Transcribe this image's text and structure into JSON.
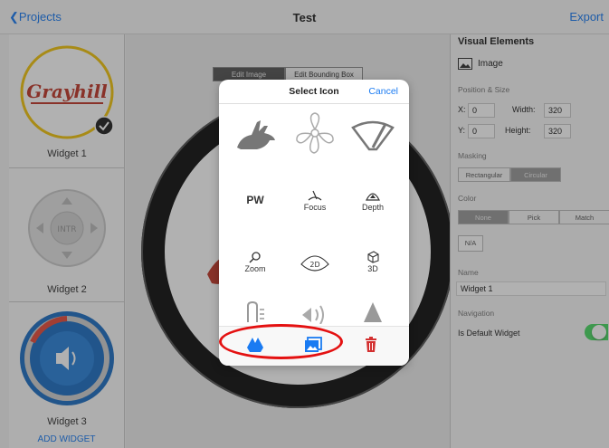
{
  "navbar": {
    "back_label": "Projects",
    "title": "Test",
    "right_label": "Export"
  },
  "widgets": [
    {
      "label": "Widget 1",
      "logo_text": "Grayhill"
    },
    {
      "label": "Widget 2",
      "center_text": "INTR"
    },
    {
      "label": "Widget 3"
    }
  ],
  "add_widget_label": "ADD WIDGET",
  "canvas": {
    "tab_edit_image": "Edit Image",
    "tab_edit_bbox": "Edit Bounding Box"
  },
  "right_panel": {
    "section_title": "Visual Elements",
    "element_type": "Image",
    "position_size_label": "Position & Size",
    "x_label": "X:",
    "x_value": "0",
    "y_label": "Y:",
    "y_value": "0",
    "width_label": "Width:",
    "width_value": "320",
    "height_label": "Height:",
    "height_value": "320",
    "masking_label": "Masking",
    "masking_options": [
      "Rectangular",
      "Circular"
    ],
    "color_label": "Color",
    "color_options": [
      "None",
      "Pick",
      "Match"
    ],
    "color_na": "N/A",
    "name_label": "Name",
    "name_value": "Widget 1",
    "navigation_label": "Navigation",
    "default_widget_label": "Is Default Widget",
    "accent": "#4cd964"
  },
  "modal": {
    "title": "Select Icon",
    "cancel": "Cancel",
    "icons": [
      {
        "name": "rabbit"
      },
      {
        "name": "fan"
      },
      {
        "name": "wiper"
      },
      {
        "name": "pw",
        "text": "PW"
      },
      {
        "name": "focus",
        "text": "Focus"
      },
      {
        "name": "depth",
        "text": "Depth"
      },
      {
        "name": "zoom",
        "text": "Zoom"
      },
      {
        "name": "2d",
        "text": "2D"
      },
      {
        "name": "3d",
        "text": "3D"
      },
      {
        "name": "light-beam"
      },
      {
        "name": "volume"
      },
      {
        "name": "cone"
      }
    ],
    "toolbar": [
      "google-drive-icon",
      "photo-library-icon",
      "trash-icon"
    ]
  },
  "colors": {
    "accent": "#1a7bf2",
    "highlight_ring": "#e41111",
    "delete": "#d32f2f"
  }
}
